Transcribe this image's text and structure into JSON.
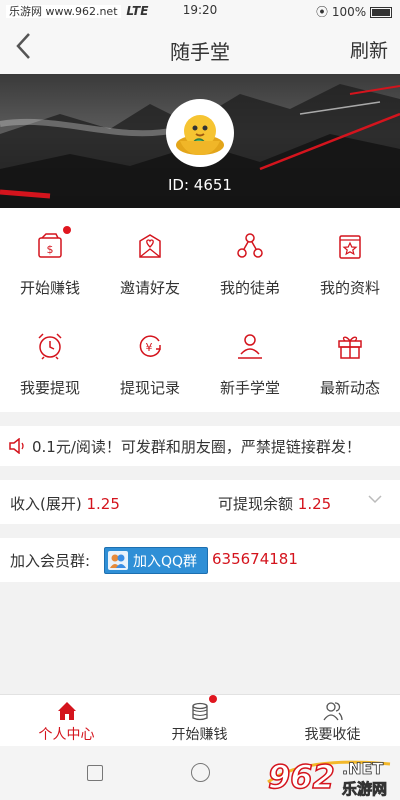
{
  "status_bar": {
    "watermark": "乐游网 www.962.net",
    "network": "LTE",
    "time": "19:20",
    "battery": "100%"
  },
  "header": {
    "back_icon": "chevron-left-icon",
    "title": "随手堂",
    "refresh_label": "刷新"
  },
  "profile": {
    "id_text": "ID: 4651",
    "avatar_icon": "gold-ingot-chick-avatar"
  },
  "menu": {
    "items": [
      {
        "label": "开始赚钱",
        "icon": "wallet-dollar-icon",
        "badge": true
      },
      {
        "label": "邀请好友",
        "icon": "heart-envelope-icon",
        "badge": false
      },
      {
        "label": "我的徒弟",
        "icon": "share-nodes-icon",
        "badge": false
      },
      {
        "label": "我的资料",
        "icon": "star-book-icon",
        "badge": false
      },
      {
        "label": "我要提现",
        "icon": "alarm-clock-icon",
        "badge": false
      },
      {
        "label": "提现记录",
        "icon": "yen-transfer-icon",
        "badge": false
      },
      {
        "label": "新手学堂",
        "icon": "person-stand-icon",
        "badge": false
      },
      {
        "label": "最新动态",
        "icon": "gift-icon",
        "badge": false
      }
    ]
  },
  "notice": {
    "icon": "speaker-icon",
    "text": "0.1元/阅读！可发群和朋友圈，严禁提链接群发！"
  },
  "income": {
    "label": "收入(展开)",
    "value": "1.25",
    "withdrawable_label": "可提现余额",
    "withdrawable_value": "1.25"
  },
  "group": {
    "label": "加入会员群:",
    "button_label": "加入QQ群",
    "number": "635674181"
  },
  "tabs": [
    {
      "label": "个人中心",
      "icon": "home-icon",
      "active": true
    },
    {
      "label": "开始赚钱",
      "icon": "coins-icon",
      "active": false,
      "badge": true
    },
    {
      "label": "我要收徒",
      "icon": "users-icon",
      "active": false
    }
  ],
  "watermark_logo": {
    "text_big": "962",
    "text_net": ".NET",
    "text_cn": "乐游网"
  },
  "colors": {
    "accent": "#d4141d",
    "badge": "#e0161f",
    "qq_blue": "#2f8fd6"
  }
}
